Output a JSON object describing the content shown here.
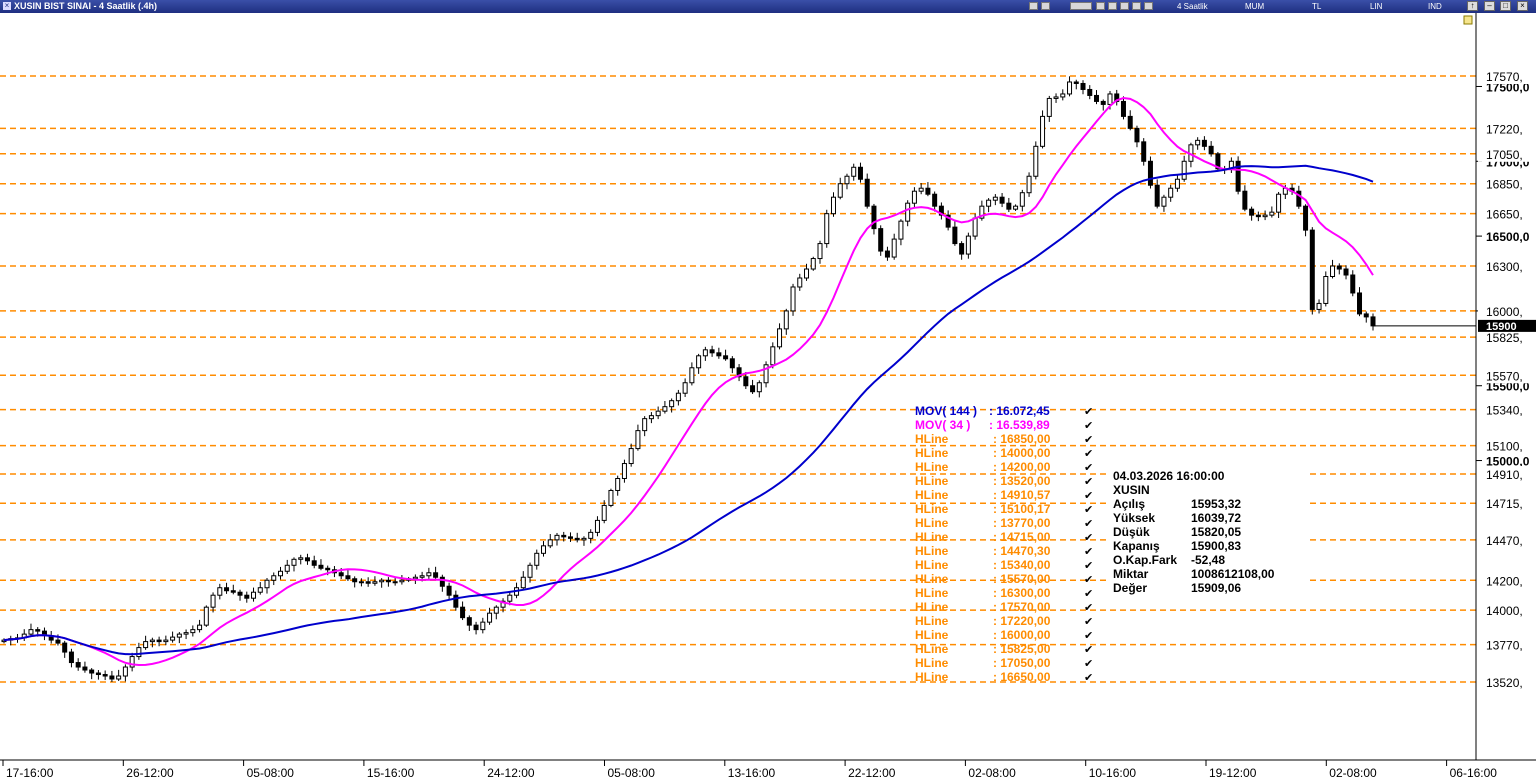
{
  "window": {
    "title": "XUSIN BIST SINAI - 4 Saatlik (.4h)",
    "toolbar": {
      "period": "4 Saatlik",
      "chart_style": "MUM",
      "currency": "TL",
      "scale": "LIN",
      "indicator": "IND"
    }
  },
  "colors": {
    "hline": "#ff8c00",
    "mov144": "#0000cc",
    "mov34": "#ff00ff",
    "candle_up": "#ffffff",
    "candle_down": "#000000",
    "titlebar": "#2a3b94"
  },
  "chart_data": {
    "type": "candlestick",
    "symbol": "XUSIN",
    "x_ticks": [
      "17-16:00",
      "26-12:00",
      "05-08:00",
      "15-16:00",
      "24-12:00",
      "05-08:00",
      "13-16:00",
      "22-12:00",
      "02-08:00",
      "10-16:00",
      "19-12:00",
      "02-08:00",
      "06-16:00"
    ],
    "y_ticks": [
      "17500,0",
      "17000,0",
      "16500,0",
      "16000,0",
      "15500,0",
      "15000,0"
    ],
    "hline_price_labels": [
      "17570,",
      "17220,",
      "17050,",
      "16850,",
      "16650,",
      "16300,",
      "16000,",
      "15825,",
      "15570,",
      "15340,",
      "15100,",
      "14910,",
      "14715,",
      "14470,",
      "14200,",
      "14000,",
      "13770,",
      "13520,"
    ],
    "hline_levels": [
      17570,
      17220,
      17050,
      16850,
      16650,
      16300,
      16000,
      15825,
      15570,
      15340,
      15100,
      14910,
      14715,
      14470,
      14200,
      14000,
      13770,
      13520
    ],
    "current_price_label": "15900",
    "legend": [
      {
        "label": "MOV( 144 )",
        "value": ": 16.072,45",
        "color": "#0000cc"
      },
      {
        "label": "MOV( 34 )",
        "value": ": 16.539,89",
        "color": "#ff00ff"
      },
      {
        "label": "HLine",
        "value": ": 16850,00",
        "color": "#ff8c00"
      },
      {
        "label": "HLine",
        "value": ": 14000,00",
        "color": "#ff8c00"
      },
      {
        "label": "HLine",
        "value": ": 14200,00",
        "color": "#ff8c00"
      },
      {
        "label": "HLine",
        "value": ": 13520,00",
        "color": "#ff8c00"
      },
      {
        "label": "HLine",
        "value": ": 14910,57",
        "color": "#ff8c00"
      },
      {
        "label": "HLine",
        "value": ": 15100,17",
        "color": "#ff8c00"
      },
      {
        "label": "HLine",
        "value": ": 13770,00",
        "color": "#ff8c00"
      },
      {
        "label": "HLine",
        "value": ": 14715,00",
        "color": "#ff8c00"
      },
      {
        "label": "HLine",
        "value": ": 14470,30",
        "color": "#ff8c00"
      },
      {
        "label": "HLine",
        "value": ": 15340,00",
        "color": "#ff8c00"
      },
      {
        "label": "HLine",
        "value": ": 15570,00",
        "color": "#ff8c00"
      },
      {
        "label": "HLine",
        "value": ": 16300,00",
        "color": "#ff8c00"
      },
      {
        "label": "HLine",
        "value": ": 17570,00",
        "color": "#ff8c00"
      },
      {
        "label": "HLine",
        "value": ": 17220,00",
        "color": "#ff8c00"
      },
      {
        "label": "HLine",
        "value": ": 16000,00",
        "color": "#ff8c00"
      },
      {
        "label": "HLine",
        "value": ": 15825,00",
        "color": "#ff8c00"
      },
      {
        "label": "HLine",
        "value": ": 17050,00",
        "color": "#ff8c00"
      },
      {
        "label": "HLine",
        "value": ": 16650,00",
        "color": "#ff8c00"
      }
    ],
    "info_box": {
      "datetime": "04.03.2026  16:00:00",
      "symbol": "XUSIN",
      "rows": [
        {
          "k": "Açılış",
          "v": "15953,32"
        },
        {
          "k": "Yüksek",
          "v": "16039,72"
        },
        {
          "k": "Düşük",
          "v": "15820,05"
        },
        {
          "k": "Kapanış",
          "v": "15900,83"
        },
        {
          "k": "O.Kap.Fark",
          "v": "-52,48"
        },
        {
          "k": "Miktar",
          "v": "1008612108,00"
        },
        {
          "k": "Değer",
          "v": "15909,06"
        }
      ]
    },
    "close_series": [
      13800,
      13810,
      13815,
      13840,
      13870,
      13860,
      13830,
      13800,
      13780,
      13720,
      13650,
      13620,
      13600,
      13580,
      13570,
      13560,
      13540,
      13560,
      13620,
      13690,
      13750,
      13790,
      13800,
      13790,
      13800,
      13820,
      13840,
      13850,
      13870,
      13900,
      14020,
      14100,
      14150,
      14130,
      14120,
      14100,
      14080,
      14120,
      14150,
      14200,
      14230,
      14260,
      14300,
      14340,
      14350,
      14330,
      14300,
      14280,
      14270,
      14250,
      14230,
      14210,
      14190,
      14190,
      14180,
      14190,
      14200,
      14190,
      14190,
      14200,
      14210,
      14220,
      14230,
      14250,
      14220,
      14160,
      14100,
      14020,
      13950,
      13900,
      13870,
      13920,
      13980,
      14020,
      14060,
      14100,
      14150,
      14220,
      14300,
      14380,
      14430,
      14470,
      14500,
      14490,
      14480,
      14470,
      14480,
      14520,
      14600,
      14700,
      14800,
      14880,
      14980,
      15080,
      15200,
      15280,
      15300,
      15330,
      15360,
      15400,
      15450,
      15520,
      15620,
      15700,
      15740,
      15720,
      15700,
      15680,
      15620,
      15560,
      15500,
      15460,
      15520,
      15640,
      15760,
      15880,
      16000,
      16160,
      16220,
      16280,
      16350,
      16450,
      16650,
      16760,
      16850,
      16900,
      16960,
      16880,
      16700,
      16550,
      16400,
      16360,
      16480,
      16600,
      16720,
      16800,
      16820,
      16780,
      16700,
      16640,
      16560,
      16450,
      16380,
      16500,
      16620,
      16700,
      16740,
      16760,
      16720,
      16680,
      16700,
      16790,
      16900,
      17100,
      17300,
      17420,
      17430,
      17450,
      17530,
      17520,
      17480,
      17440,
      17400,
      17380,
      17450,
      17400,
      17300,
      17220,
      17130,
      17000,
      16840,
      16700,
      16760,
      16820,
      16880,
      17000,
      17110,
      17140,
      17100,
      17050,
      16950,
      16950,
      17000,
      16800,
      16680,
      16640,
      16630,
      16640,
      16660,
      16780,
      16820,
      16800,
      16700,
      16540,
      16010,
      16050,
      16230,
      16300,
      16280,
      16240,
      16120,
      15980,
      15960,
      15900
    ]
  }
}
